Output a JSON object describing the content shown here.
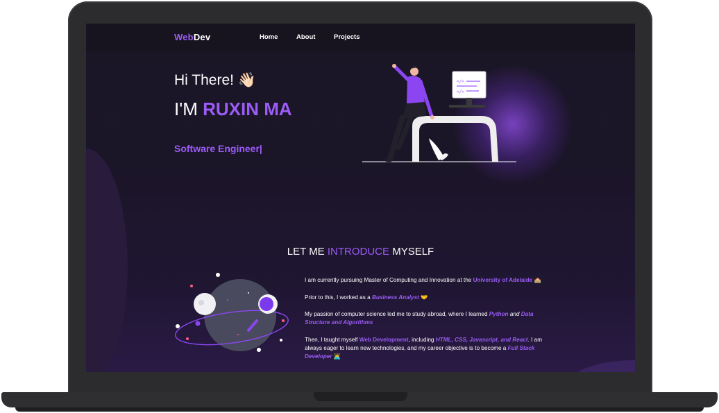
{
  "nav": {
    "logo_accent": "Web",
    "logo_rest": "Dev",
    "links": [
      "Home",
      "About",
      "Projects"
    ]
  },
  "hero": {
    "greeting": "Hi There! 👋🏻",
    "name_prefix": "I'M ",
    "name": "RUXIN MA",
    "role": "Software Engineer|"
  },
  "about": {
    "title_pre": "LET ME ",
    "title_hl": "INTRODUCE",
    "title_post": " MYSELF",
    "p1_a": "I am currently pursuing Master of Computing and Innovation at the ",
    "p1_link": "University of Adelaide",
    "p1_emoji": " 🏫",
    "p2_a": "Prior to this, I worked as a ",
    "p2_link": "Business Analyst",
    "p2_emoji": " 🤝",
    "p3_a": "My passion of computer science led me to study abroad, where I learned ",
    "p3_l1": "Python",
    "p3_b": " and ",
    "p3_l2": "Data Structure and Algorithms",
    "p4_a": "Then, I taught myself ",
    "p4_l1": "Web Development",
    "p4_b": ", including ",
    "p4_l2": "HTML, CSS, Javascript, and React",
    "p4_c": ". I am always eager to learn new technologies, and my career objective is to become a ",
    "p4_l3": "Full Stack Developer",
    "p4_emoji": " 🧑‍💻"
  },
  "colors": {
    "accent": "#9b5cf6",
    "background": "#1a1626",
    "navbar": "#18141f",
    "laptop_frame": "#2c2c2e"
  }
}
